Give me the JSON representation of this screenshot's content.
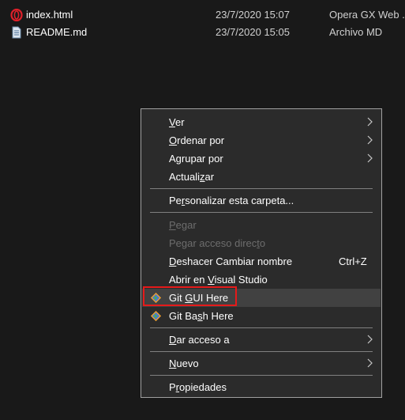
{
  "files": [
    {
      "name": "index.html",
      "date": "23/7/2020 15:07",
      "type": "Opera GX Web ...",
      "icon": "opera-icon"
    },
    {
      "name": "README.md",
      "date": "23/7/2020 15:05",
      "type": "Archivo MD",
      "icon": "text-file-icon"
    }
  ],
  "menu": {
    "ver": {
      "pre": "",
      "key": "V",
      "post": "er"
    },
    "ordenar": {
      "pre": "",
      "key": "O",
      "post": "rdenar por"
    },
    "agrupar": {
      "pre": "A",
      "key": "g",
      "post": "rupar por"
    },
    "actualizar": {
      "pre": "Actuali",
      "key": "z",
      "post": "ar"
    },
    "personalizar": {
      "pre": "Pe",
      "key": "r",
      "post": "sonalizar esta carpeta..."
    },
    "pegar": {
      "pre": "",
      "key": "P",
      "post": "egar"
    },
    "pegar_acceso": {
      "pre": "Pegar acceso direc",
      "key": "t",
      "post": "o"
    },
    "deshacer": {
      "pre": "",
      "key": "D",
      "post": "eshacer Cambiar nombre",
      "shortcut": "Ctrl+Z"
    },
    "abrir_vs": {
      "pre": "Abrir en ",
      "key": "V",
      "post": "isual Studio"
    },
    "git_gui": {
      "pre": "Git ",
      "key": "G",
      "post": "UI Here"
    },
    "git_bash": {
      "pre": "Git Ba",
      "key": "s",
      "post": "h Here"
    },
    "dar_acceso": {
      "pre": "",
      "key": "D",
      "post": "ar acceso a"
    },
    "nuevo": {
      "pre": "",
      "key": "N",
      "post": "uevo"
    },
    "propiedades": {
      "pre": "P",
      "key": "r",
      "post": "opiedades"
    }
  },
  "colors": {
    "background": "#191919",
    "menu_bg": "#2b2b2b",
    "menu_hover": "#414141",
    "highlight_box": "#e51a1a",
    "disabled_text": "#6d6d6d"
  }
}
